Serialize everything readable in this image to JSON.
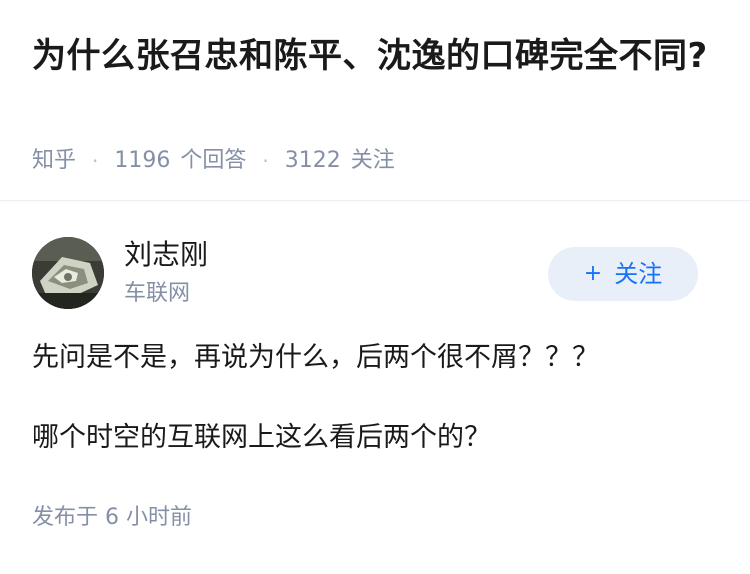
{
  "question": {
    "title": "为什么张召忠和陈平、沈逸的口碑完全不同?",
    "source": "知乎",
    "answer_count": "1196",
    "answer_label": "个回答",
    "follow_count": "3122",
    "follow_label": "关注"
  },
  "answer": {
    "author_name": "刘志刚",
    "author_org": "车联网",
    "follow_button_label": "关注",
    "follow_button_icon": "plus-icon",
    "paragraphs": [
      "先问是不是，再说为什么，后两个很不屑？？？",
      "哪个时空的互联网上这么看后两个的？"
    ],
    "publish_time": "发布于 6 小时前"
  },
  "colors": {
    "accent": "#1772f6",
    "follow_bg": "#e9eff8",
    "meta_gray": "#8590a6"
  }
}
